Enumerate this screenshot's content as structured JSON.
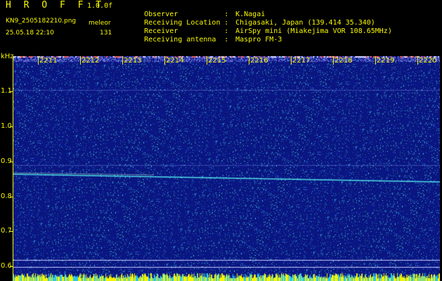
{
  "header": {
    "app_title": "H R O F F T",
    "version": "1.0.0f",
    "filename": "KN9_2505182210.png",
    "mode": "meleor",
    "datetime": "25.05.18 22:10",
    "count": "131"
  },
  "info": [
    {
      "label": "Observer",
      "value": "K.Nagai"
    },
    {
      "label": "Receiving Location",
      "value": "Chigasaki, Japan (139.414 35.340)"
    },
    {
      "label": "Receiver",
      "value": "AirSpy mini (Miakejima VOR 108.65MHz)"
    },
    {
      "label": "Receiving antenna",
      "value": "Maspro FM-3"
    }
  ],
  "separator": ":",
  "yaxis": {
    "unit": "kHz",
    "ticks": [
      "1.1",
      "1.0",
      "0.9",
      "0.8",
      "0.7",
      "0.6"
    ]
  },
  "xaxis": {
    "ticks": [
      "2211",
      "2212",
      "2213",
      "2214",
      "2215",
      "2216",
      "2217",
      "2218",
      "2219",
      "2220"
    ]
  },
  "colors": {
    "background": "#000000",
    "text": "#f4f400",
    "spectrum_bg": "#0b1a7a",
    "carrier_line": "#4fe0e8",
    "bottom_bar": "#f4f400"
  }
}
